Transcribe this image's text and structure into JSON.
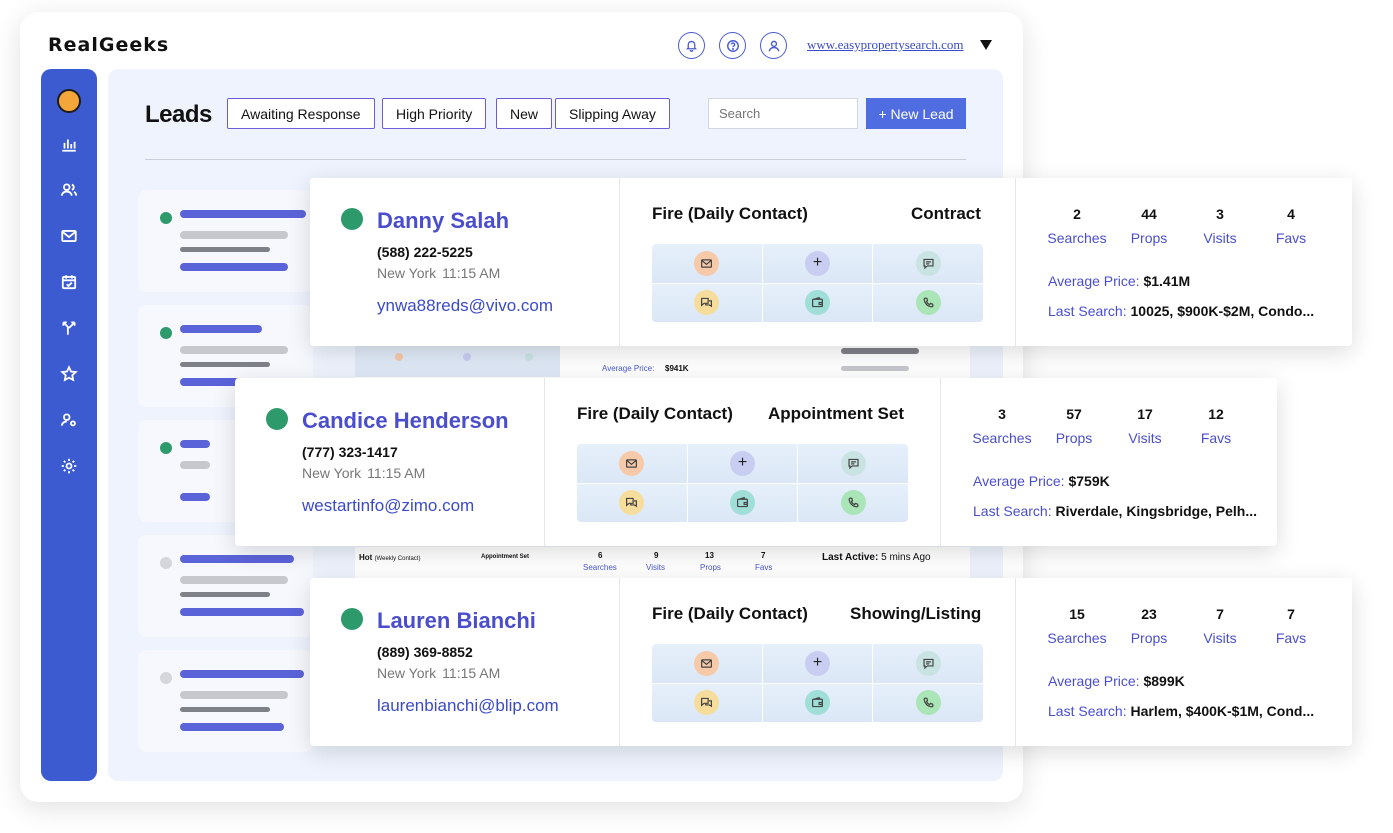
{
  "brand": "RealGeeks",
  "header": {
    "site_url": "www.easypropertysearch.com",
    "icons": [
      "bell-icon",
      "help-icon",
      "user-icon"
    ]
  },
  "sidebar": {
    "icons": [
      "avatar",
      "chart-icon",
      "users-icon",
      "mail-icon",
      "calendar-icon",
      "branch-icon",
      "star-icon",
      "user-settings-icon",
      "gear-icon"
    ]
  },
  "leads_page": {
    "title": "Leads",
    "filters": [
      "Awaiting Response",
      "High Priority",
      "New",
      "Slipping Away"
    ],
    "search_placeholder": "Search",
    "new_lead_label": "+ New Lead"
  },
  "background_rows": {
    "row2_avg_price_label": "Average Price:",
    "row2_avg_price_value": "$941K",
    "row4": {
      "stage": "Hot",
      "stage_sub": "(Weekly Contact)",
      "status": "Appointment Set",
      "stats": [
        {
          "num": "6",
          "label": "Searches"
        },
        {
          "num": "9",
          "label": "Visits"
        },
        {
          "num": "13",
          "label": "Props"
        },
        {
          "num": "7",
          "label": "Favs"
        }
      ],
      "last_active_label": "Last Active:",
      "last_active_value": "5 mins Ago"
    }
  },
  "leads": [
    {
      "name": "Danny Salah",
      "phone": "(588) 222-5225",
      "city": "New York",
      "time": "11:15 AM",
      "email": "ynwa88reds@vivo.com",
      "stage": "Fire (Daily Contact)",
      "status": "Contract",
      "stats": [
        {
          "num": "2",
          "label": "Searches"
        },
        {
          "num": "44",
          "label": "Props"
        },
        {
          "num": "3",
          "label": "Visits"
        },
        {
          "num": "4",
          "label": "Favs"
        }
      ],
      "avg_price_label": "Average Price:",
      "avg_price": "$1.41M",
      "last_search_label": "Last Search:",
      "last_search": "10025, $900K-$2M, Condo..."
    },
    {
      "name": "Candice Henderson",
      "phone": "(777) 323-1417",
      "city": "New York",
      "time": "11:15 AM",
      "email": "westartinfo@zimo.com",
      "stage": "Fire (Daily Contact)",
      "status": "Appointment Set",
      "stats": [
        {
          "num": "3",
          "label": "Searches"
        },
        {
          "num": "57",
          "label": "Props"
        },
        {
          "num": "17",
          "label": "Visits"
        },
        {
          "num": "12",
          "label": "Favs"
        }
      ],
      "avg_price_label": "Average Price:",
      "avg_price": "$759K",
      "last_search_label": "Last Search:",
      "last_search": "Riverdale, Kingsbridge, Pelh..."
    },
    {
      "name": "Lauren Bianchi",
      "phone": "(889) 369-8852",
      "city": "New York",
      "time": "11:15 AM",
      "email": "laurenbianchi@blip.com",
      "stage": "Fire (Daily Contact)",
      "status": "Showing/Listing",
      "stats": [
        {
          "num": "15",
          "label": "Searches"
        },
        {
          "num": "23",
          "label": "Props"
        },
        {
          "num": "7",
          "label": "Visits"
        },
        {
          "num": "7",
          "label": "Favs"
        }
      ],
      "avg_price_label": "Average Price:",
      "avg_price": "$899K",
      "last_search_label": "Last Search:",
      "last_search": "Harlem, $400K-$1M, Cond..."
    }
  ],
  "colors": {
    "accent": "#4a4ecc",
    "sidebar": "#3d5bd1",
    "status_green": "#2e9a6c",
    "button": "#4f6de0"
  }
}
